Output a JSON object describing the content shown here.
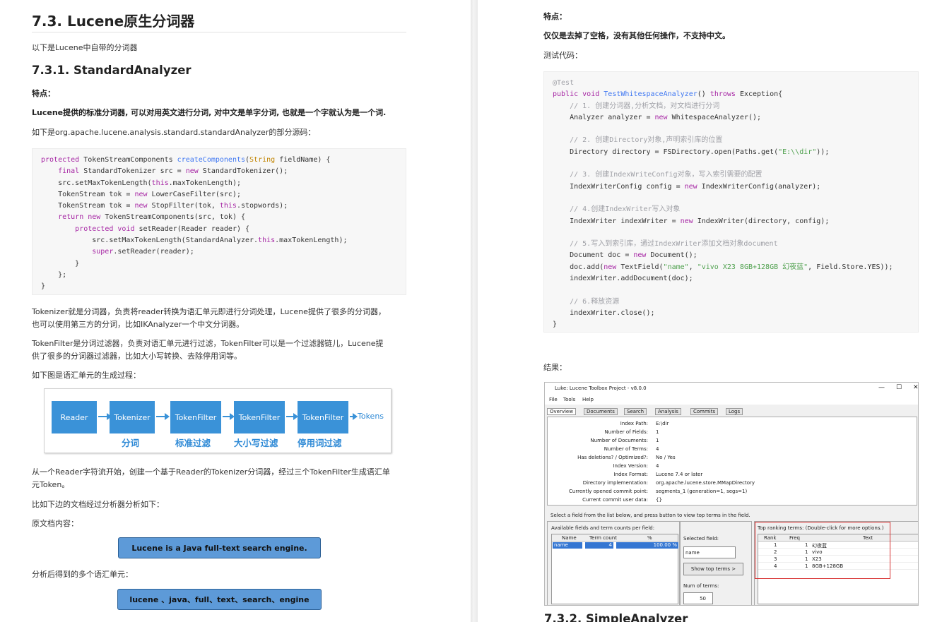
{
  "left": {
    "heading": "7.3. Lucene原生分词器",
    "intro": "以下是Lucene中自带的分词器",
    "sub_heading": "7.3.1. StandardAnalyzer",
    "feature_label": "特点：",
    "feature_text": "Lucene提供的标准分词器, 可以对用英文进行分词, 对中文是单字分词, 也就是一个字就认为是一个词.",
    "source_intro": "如下是org.apache.lucene.analysis.standard.standardAnalyzer的部分源码：",
    "para_tokenizer_1": "Tokenizer就是分词器，负责将reader转换为语汇单元即进行分词处理，Lucene提供了很多的分词器，",
    "para_tokenizer_2": "也可以使用第三方的分词，比如IKAnalyzer一个中文分词器。",
    "para_filter_1": "TokenFilter是分词过滤器，负责对语汇单元进行过滤，TokenFilter可以是一个过滤器链儿，Lucene提",
    "para_filter_2": "供了很多的分词器过滤器，比如大小写转换、去除停用词等。",
    "para_diagram": "如下图是语汇单元的生成过程：",
    "para_flow_1": "从一个Reader字符流开始，创建一个基于Reader的Tokenizer分词器，经过三个TokenFilter生成语汇单",
    "para_flow_2": "元Token。",
    "para_example": "比如下边的文档经过分析器分析如下：",
    "para_original": "原文档内容：",
    "original_text": "Lucene is a Java full-text search engine.",
    "para_units": "分析后得到的多个语汇单元：",
    "units_text": "lucene 、java、full、text、search、engine",
    "flow": {
      "boxes": [
        "Reader",
        "Tokenizer",
        "TokenFilter",
        "TokenFilter",
        "TokenFilter"
      ],
      "end_label": "Tokens",
      "captions": [
        "分词",
        "标准过滤",
        "大小写过滤",
        "停用词过滤"
      ]
    }
  },
  "right": {
    "feature_label": "特点：",
    "feature_text": "仅仅是去掉了空格，没有其他任何操作，不支持中文。",
    "test_label": "测试代码：",
    "result_label": "结果：",
    "next_heading": "7.3.2. SimpleAnalyzer"
  },
  "luke": {
    "title": "Luke: Lucene Toolbox Project - v8.0.0",
    "controls": [
      "—",
      "☐",
      "✕"
    ],
    "menu": [
      "File",
      "Tools",
      "Help"
    ],
    "tabs": [
      "Overview",
      "Documents",
      "Search",
      "Analysis",
      "Commits",
      "Logs"
    ],
    "overview": [
      {
        "k": "Index Path:",
        "v": "E:\\dir"
      },
      {
        "k": "Number of Fields:",
        "v": "1"
      },
      {
        "k": "Number of Documents:",
        "v": "1"
      },
      {
        "k": "Number of Terms:",
        "v": "4"
      },
      {
        "k": "Has deletions? / Optimized?:",
        "v": "No / Yes"
      },
      {
        "k": "Index Version:",
        "v": "4"
      },
      {
        "k": "Index Format:",
        "v": "Lucene 7.4 or later"
      },
      {
        "k": "Directory implementation:",
        "v": "org.apache.lucene.store.MMapDirectory"
      },
      {
        "k": "Currently opened commit point:",
        "v": "segments_1 (generation=1, segs=1)"
      },
      {
        "k": "Current commit user data:",
        "v": "{}"
      }
    ],
    "hint": "Select a field from the list below, and press button to view top terms in the field.",
    "fields_label": "Available fields and term counts per field:",
    "fields_headers": [
      "Name",
      "Term count",
      "%"
    ],
    "fields_row": [
      "name",
      "4",
      "100.00 %"
    ],
    "selected_label": "Selected field:",
    "selected_value": "name",
    "show_button": "Show top terms >",
    "num_terms_label": "Num of terms:",
    "num_terms_value": "50",
    "top_label": "Top ranking terms: (Double-click for more options.)",
    "top_headers": [
      "Rank",
      "Freq",
      "Text"
    ],
    "top_rows": [
      [
        "1",
        "1",
        "幻夜蓝"
      ],
      [
        "2",
        "1",
        "vivo"
      ],
      [
        "3",
        "1",
        "X23"
      ],
      [
        "4",
        "1",
        "8GB+128GB"
      ]
    ]
  },
  "colors": {
    "flow_blue": "#3a92d8",
    "pill_blue": "#5d9ad8",
    "keyword": "#a626a4",
    "function": "#4078f2",
    "string": "#50a14f",
    "highlight_red": "#d83030"
  }
}
